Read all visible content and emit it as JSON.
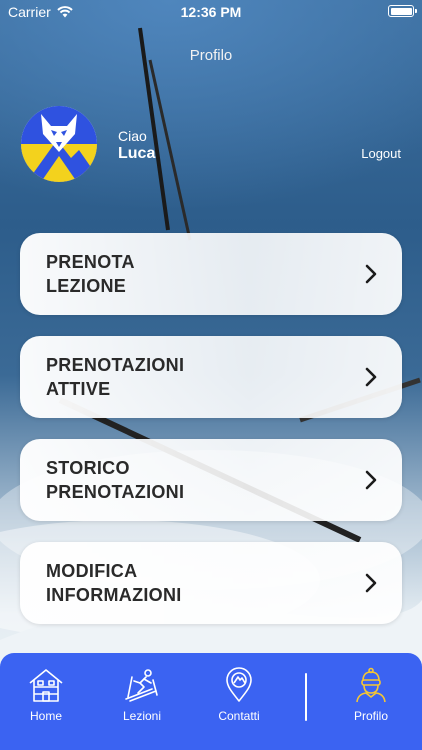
{
  "status_bar": {
    "carrier": "Carrier",
    "time": "12:36 PM"
  },
  "header": {
    "title": "Profilo"
  },
  "profile": {
    "greeting": "Ciao",
    "name": "Luca",
    "logout_label": "Logout",
    "avatar_icon": "wolf-mountain-logo"
  },
  "menu": [
    {
      "line1": "PRENOTA",
      "line2": "LEZIONE"
    },
    {
      "line1": "PRENOTAZIONI",
      "line2": "ATTIVE"
    },
    {
      "line1": "STORICO",
      "line2": "PRENOTAZIONI"
    },
    {
      "line1": "MODIFICA",
      "line2": "INFORMAZIONI"
    }
  ],
  "tabs": [
    {
      "label": "Home",
      "icon": "chalet-icon"
    },
    {
      "label": "Lezioni",
      "icon": "skier-icon"
    },
    {
      "label": "Contatti",
      "icon": "map-pin-icon"
    },
    {
      "label": "Profilo",
      "icon": "instructor-icon"
    }
  ],
  "colors": {
    "tab_bar": "#3b63f2",
    "active_tab": "#f6c633",
    "logo_blue": "#2f52e0",
    "logo_yellow": "#f3d21d"
  }
}
